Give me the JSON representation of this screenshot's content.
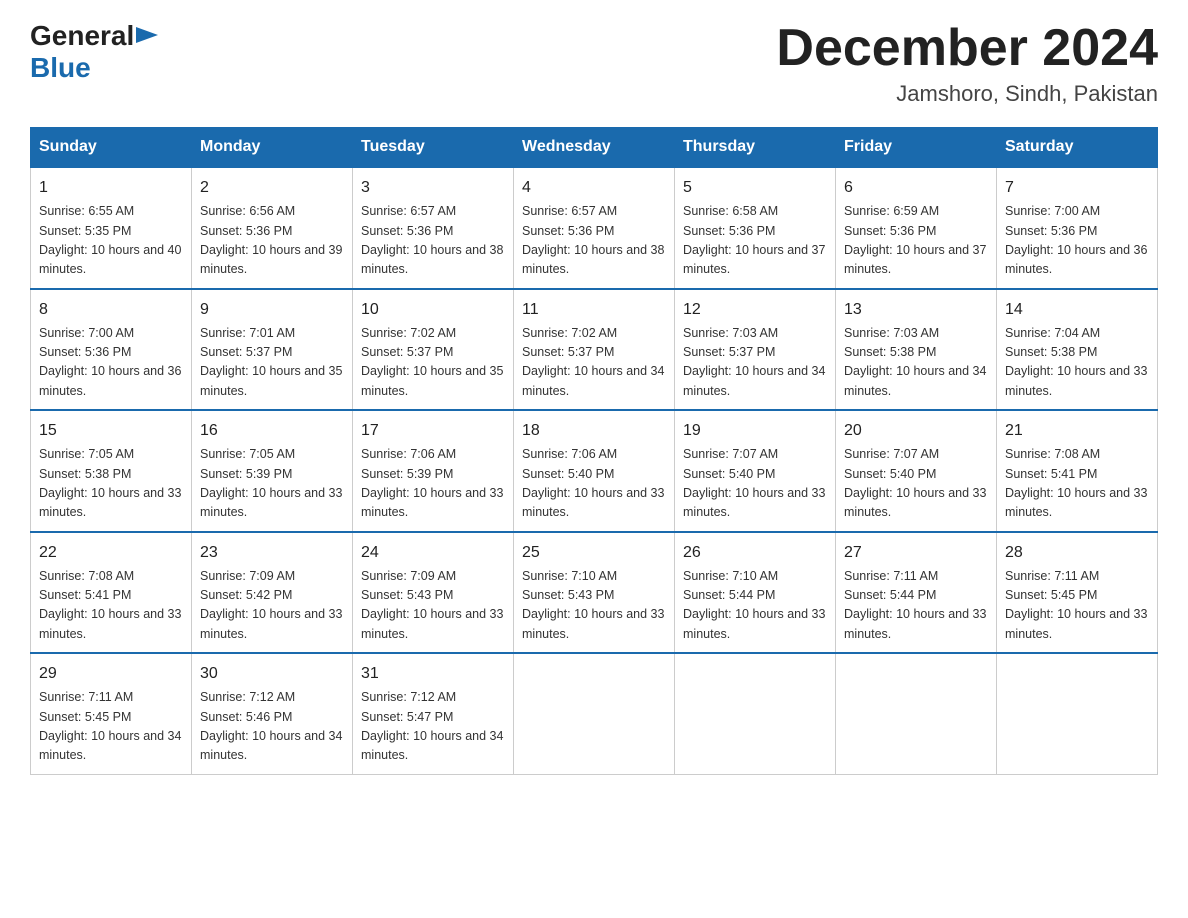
{
  "logo": {
    "general": "General",
    "arrow": "",
    "blue": "Blue"
  },
  "header": {
    "month": "December 2024",
    "location": "Jamshoro, Sindh, Pakistan"
  },
  "days_of_week": [
    "Sunday",
    "Monday",
    "Tuesday",
    "Wednesday",
    "Thursday",
    "Friday",
    "Saturday"
  ],
  "weeks": [
    [
      {
        "day": "1",
        "sunrise": "Sunrise: 6:55 AM",
        "sunset": "Sunset: 5:35 PM",
        "daylight": "Daylight: 10 hours and 40 minutes."
      },
      {
        "day": "2",
        "sunrise": "Sunrise: 6:56 AM",
        "sunset": "Sunset: 5:36 PM",
        "daylight": "Daylight: 10 hours and 39 minutes."
      },
      {
        "day": "3",
        "sunrise": "Sunrise: 6:57 AM",
        "sunset": "Sunset: 5:36 PM",
        "daylight": "Daylight: 10 hours and 38 minutes."
      },
      {
        "day": "4",
        "sunrise": "Sunrise: 6:57 AM",
        "sunset": "Sunset: 5:36 PM",
        "daylight": "Daylight: 10 hours and 38 minutes."
      },
      {
        "day": "5",
        "sunrise": "Sunrise: 6:58 AM",
        "sunset": "Sunset: 5:36 PM",
        "daylight": "Daylight: 10 hours and 37 minutes."
      },
      {
        "day": "6",
        "sunrise": "Sunrise: 6:59 AM",
        "sunset": "Sunset: 5:36 PM",
        "daylight": "Daylight: 10 hours and 37 minutes."
      },
      {
        "day": "7",
        "sunrise": "Sunrise: 7:00 AM",
        "sunset": "Sunset: 5:36 PM",
        "daylight": "Daylight: 10 hours and 36 minutes."
      }
    ],
    [
      {
        "day": "8",
        "sunrise": "Sunrise: 7:00 AM",
        "sunset": "Sunset: 5:36 PM",
        "daylight": "Daylight: 10 hours and 36 minutes."
      },
      {
        "day": "9",
        "sunrise": "Sunrise: 7:01 AM",
        "sunset": "Sunset: 5:37 PM",
        "daylight": "Daylight: 10 hours and 35 minutes."
      },
      {
        "day": "10",
        "sunrise": "Sunrise: 7:02 AM",
        "sunset": "Sunset: 5:37 PM",
        "daylight": "Daylight: 10 hours and 35 minutes."
      },
      {
        "day": "11",
        "sunrise": "Sunrise: 7:02 AM",
        "sunset": "Sunset: 5:37 PM",
        "daylight": "Daylight: 10 hours and 34 minutes."
      },
      {
        "day": "12",
        "sunrise": "Sunrise: 7:03 AM",
        "sunset": "Sunset: 5:37 PM",
        "daylight": "Daylight: 10 hours and 34 minutes."
      },
      {
        "day": "13",
        "sunrise": "Sunrise: 7:03 AM",
        "sunset": "Sunset: 5:38 PM",
        "daylight": "Daylight: 10 hours and 34 minutes."
      },
      {
        "day": "14",
        "sunrise": "Sunrise: 7:04 AM",
        "sunset": "Sunset: 5:38 PM",
        "daylight": "Daylight: 10 hours and 33 minutes."
      }
    ],
    [
      {
        "day": "15",
        "sunrise": "Sunrise: 7:05 AM",
        "sunset": "Sunset: 5:38 PM",
        "daylight": "Daylight: 10 hours and 33 minutes."
      },
      {
        "day": "16",
        "sunrise": "Sunrise: 7:05 AM",
        "sunset": "Sunset: 5:39 PM",
        "daylight": "Daylight: 10 hours and 33 minutes."
      },
      {
        "day": "17",
        "sunrise": "Sunrise: 7:06 AM",
        "sunset": "Sunset: 5:39 PM",
        "daylight": "Daylight: 10 hours and 33 minutes."
      },
      {
        "day": "18",
        "sunrise": "Sunrise: 7:06 AM",
        "sunset": "Sunset: 5:40 PM",
        "daylight": "Daylight: 10 hours and 33 minutes."
      },
      {
        "day": "19",
        "sunrise": "Sunrise: 7:07 AM",
        "sunset": "Sunset: 5:40 PM",
        "daylight": "Daylight: 10 hours and 33 minutes."
      },
      {
        "day": "20",
        "sunrise": "Sunrise: 7:07 AM",
        "sunset": "Sunset: 5:40 PM",
        "daylight": "Daylight: 10 hours and 33 minutes."
      },
      {
        "day": "21",
        "sunrise": "Sunrise: 7:08 AM",
        "sunset": "Sunset: 5:41 PM",
        "daylight": "Daylight: 10 hours and 33 minutes."
      }
    ],
    [
      {
        "day": "22",
        "sunrise": "Sunrise: 7:08 AM",
        "sunset": "Sunset: 5:41 PM",
        "daylight": "Daylight: 10 hours and 33 minutes."
      },
      {
        "day": "23",
        "sunrise": "Sunrise: 7:09 AM",
        "sunset": "Sunset: 5:42 PM",
        "daylight": "Daylight: 10 hours and 33 minutes."
      },
      {
        "day": "24",
        "sunrise": "Sunrise: 7:09 AM",
        "sunset": "Sunset: 5:43 PM",
        "daylight": "Daylight: 10 hours and 33 minutes."
      },
      {
        "day": "25",
        "sunrise": "Sunrise: 7:10 AM",
        "sunset": "Sunset: 5:43 PM",
        "daylight": "Daylight: 10 hours and 33 minutes."
      },
      {
        "day": "26",
        "sunrise": "Sunrise: 7:10 AM",
        "sunset": "Sunset: 5:44 PM",
        "daylight": "Daylight: 10 hours and 33 minutes."
      },
      {
        "day": "27",
        "sunrise": "Sunrise: 7:11 AM",
        "sunset": "Sunset: 5:44 PM",
        "daylight": "Daylight: 10 hours and 33 minutes."
      },
      {
        "day": "28",
        "sunrise": "Sunrise: 7:11 AM",
        "sunset": "Sunset: 5:45 PM",
        "daylight": "Daylight: 10 hours and 33 minutes."
      }
    ],
    [
      {
        "day": "29",
        "sunrise": "Sunrise: 7:11 AM",
        "sunset": "Sunset: 5:45 PM",
        "daylight": "Daylight: 10 hours and 34 minutes."
      },
      {
        "day": "30",
        "sunrise": "Sunrise: 7:12 AM",
        "sunset": "Sunset: 5:46 PM",
        "daylight": "Daylight: 10 hours and 34 minutes."
      },
      {
        "day": "31",
        "sunrise": "Sunrise: 7:12 AM",
        "sunset": "Sunset: 5:47 PM",
        "daylight": "Daylight: 10 hours and 34 minutes."
      },
      null,
      null,
      null,
      null
    ]
  ]
}
